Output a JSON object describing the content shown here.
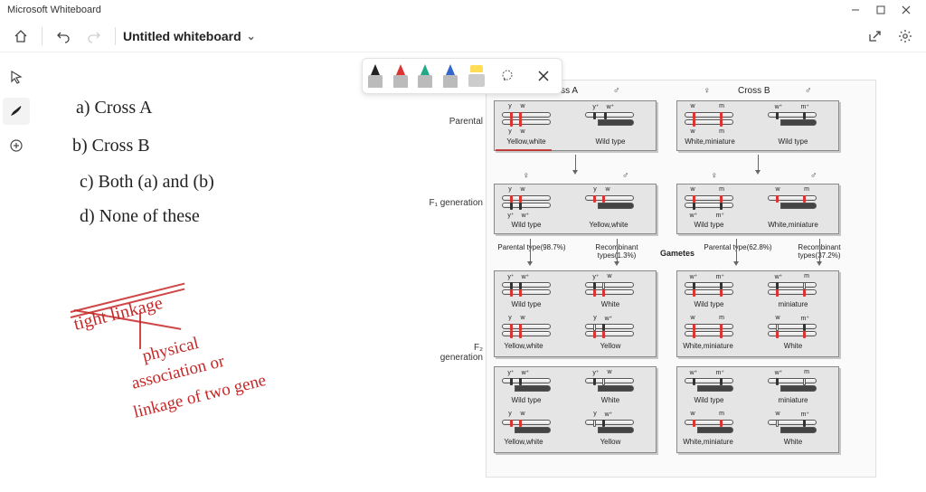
{
  "app": {
    "title": "Microsoft Whiteboard"
  },
  "toolbar": {
    "board_title": "Untitled whiteboard"
  },
  "handwriting": {
    "a": "a) Cross A",
    "b": "b) Cross B",
    "c": "c) Both (a) and (b)",
    "d": "d) None of these",
    "r1": "tight linkage",
    "r2": "physical",
    "r3": "association or",
    "r4": "linkage of two gene"
  },
  "figure": {
    "sections": {
      "parental": "Parental",
      "f1": "F₁ generation",
      "f2": "F₂ generation"
    },
    "crossA": {
      "title": "Cross A"
    },
    "crossB": {
      "title": "Cross B"
    },
    "gametes_label": "Gametes",
    "percentages": {
      "A_par": "Parental type(98.7%)",
      "A_rec": "Recombinant types(1.3%)",
      "B_par": "Parental type(62.8%)",
      "B_rec": "Recombinant types(37.2%)"
    },
    "alleles": {
      "y": "y",
      "w": "w",
      "yp": "y⁺",
      "wp": "w⁺",
      "m": "m",
      "mp": "m⁺"
    },
    "phen": {
      "yellow_white": "Yellow,white",
      "wild_type": "Wild type",
      "white_miniature": "White,miniature",
      "white": "White",
      "miniature": "miniature",
      "yellow": "Yellow"
    }
  }
}
